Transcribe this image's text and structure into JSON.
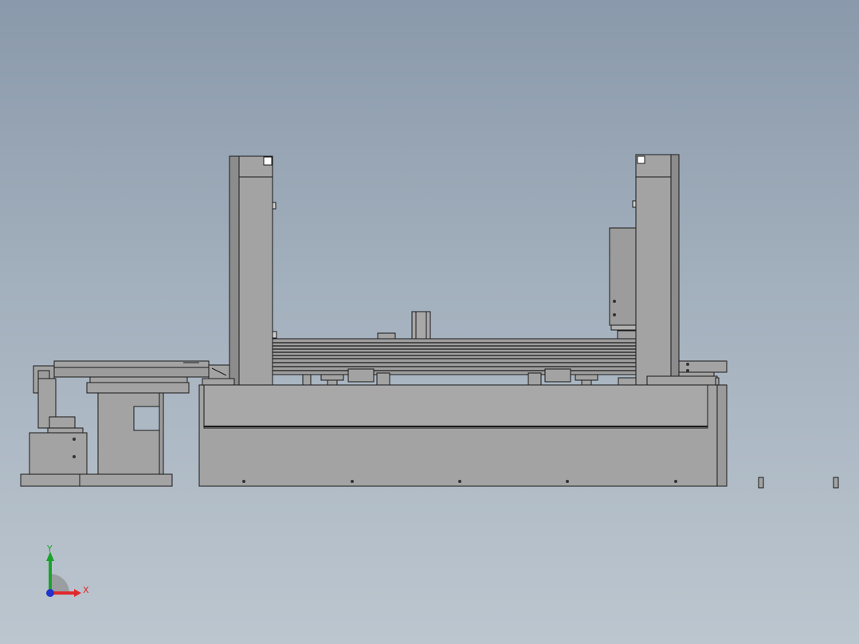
{
  "viewport": {
    "background_top": "#8a99ab",
    "background_bottom": "#bcc6cf",
    "part_fill": "#a3a3a3",
    "part_dark": "#8c8c8c",
    "edge_color": "#1a1a1a"
  },
  "triad": {
    "x_label": "X",
    "y_label": "Y",
    "x_color": "#e0282c",
    "y_color": "#1aa32a",
    "z_color": "#2233cc"
  }
}
